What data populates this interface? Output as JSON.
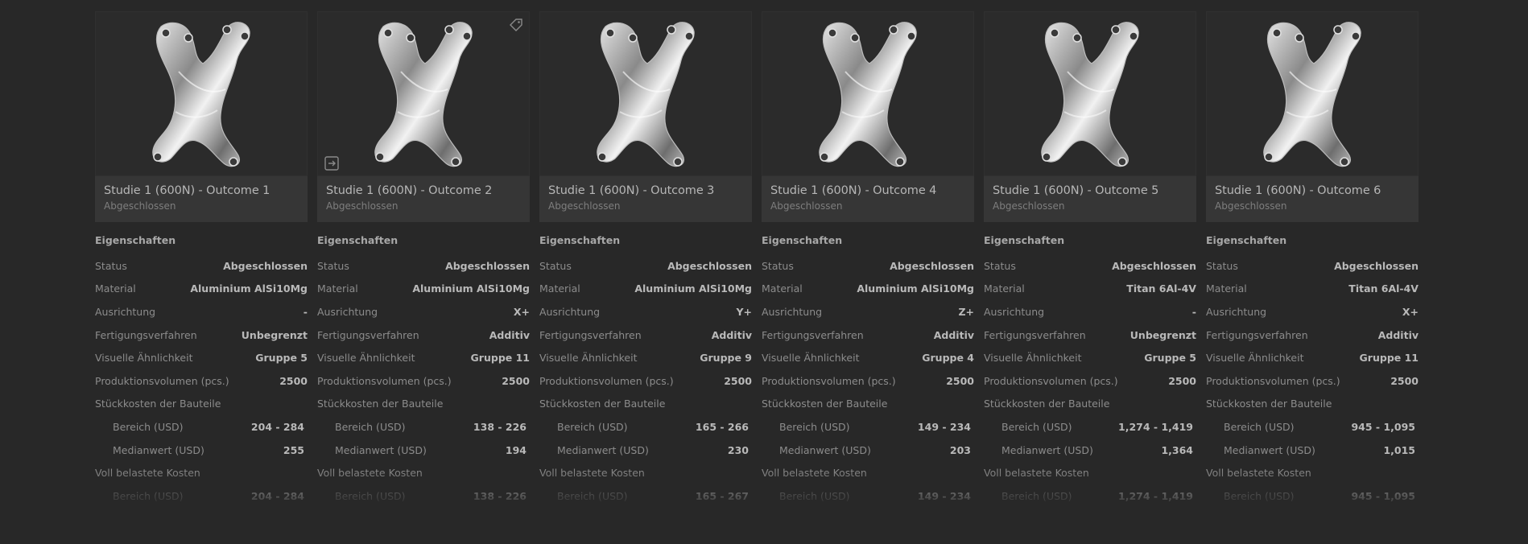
{
  "section_title": "Eigenschaften",
  "labels": {
    "status": "Status",
    "material": "Material",
    "orientation": "Ausrichtung",
    "process": "Fertigungsverfahren",
    "similarity": "Visuelle Ähnlichkeit",
    "volume": "Produktionsvolumen (pcs.)",
    "unit_cost": "Stückkosten der Bauteile",
    "range": "Bereich (USD)",
    "median": "Medianwert (USD)",
    "full_cost": "Voll belastete Kosten"
  },
  "cards": [
    {
      "title": "Studie 1 (600N) - Outcome 1",
      "subtitle": "Abgeschlossen",
      "status": "Abgeschlossen",
      "material": "Aluminium AlSi10Mg",
      "orientation": "-",
      "process": "Unbegrenzt",
      "similarity": "Gruppe 5",
      "volume": "2500",
      "range": "204 - 284",
      "median": "255",
      "full_range": "204 - 284"
    },
    {
      "title": "Studie 1 (600N) - Outcome 2",
      "subtitle": "Abgeschlossen",
      "status": "Abgeschlossen",
      "material": "Aluminium AlSi10Mg",
      "orientation": "X+",
      "process": "Additiv",
      "similarity": "Gruppe 11",
      "volume": "2500",
      "range": "138 - 226",
      "median": "194",
      "full_range": "138 - 226"
    },
    {
      "title": "Studie 1 (600N) - Outcome 3",
      "subtitle": "Abgeschlossen",
      "status": "Abgeschlossen",
      "material": "Aluminium AlSi10Mg",
      "orientation": "Y+",
      "process": "Additiv",
      "similarity": "Gruppe 9",
      "volume": "2500",
      "range": "165 - 266",
      "median": "230",
      "full_range": "165 - 267"
    },
    {
      "title": "Studie 1 (600N) - Outcome 4",
      "subtitle": "Abgeschlossen",
      "status": "Abgeschlossen",
      "material": "Aluminium AlSi10Mg",
      "orientation": "Z+",
      "process": "Additiv",
      "similarity": "Gruppe 4",
      "volume": "2500",
      "range": "149 - 234",
      "median": "203",
      "full_range": "149 - 234"
    },
    {
      "title": "Studie 1 (600N) - Outcome 5",
      "subtitle": "Abgeschlossen",
      "status": "Abgeschlossen",
      "material": "Titan 6Al-4V",
      "orientation": "-",
      "process": "Unbegrenzt",
      "similarity": "Gruppe 5",
      "volume": "2500",
      "range": "1,274 - 1,419",
      "median": "1,364",
      "full_range": "1,274 - 1,419"
    },
    {
      "title": "Studie 1 (600N) - Outcome 6",
      "subtitle": "Abgeschlossen",
      "status": "Abgeschlossen",
      "material": "Titan 6Al-4V",
      "orientation": "X+",
      "process": "Additiv",
      "similarity": "Gruppe 11",
      "volume": "2500",
      "range": "945 - 1,095",
      "median": "1,015",
      "full_range": "945 - 1,095"
    }
  ],
  "icons": {
    "tag": "tag-icon",
    "open": "open-in-icon",
    "part": "generative-design-part-thumbnail"
  }
}
